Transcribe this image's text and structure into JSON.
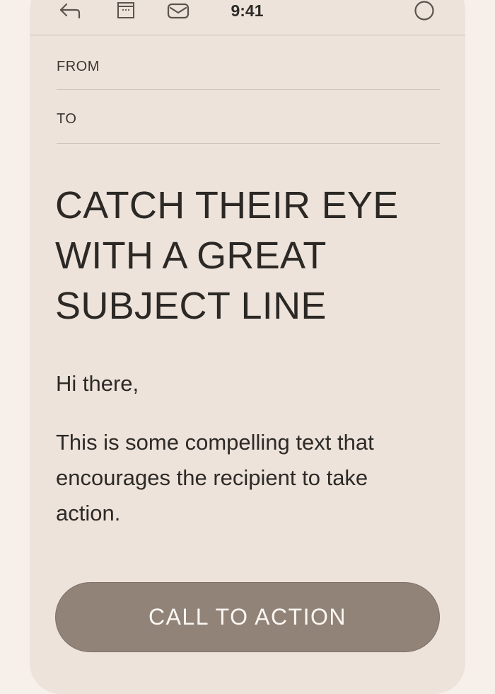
{
  "toolbar": {
    "icons": {
      "back": "reply-back-arrow-icon",
      "archive": "archive-box-icon",
      "mail": "envelope-icon",
      "status": "circle-icon"
    },
    "time": "9:41"
  },
  "fields": {
    "from_label": "FROM",
    "to_label": "TO"
  },
  "email": {
    "subject_lines": [
      "CATCH THEIR EYE",
      "WITH A GREAT",
      "SUBJECT LINE"
    ],
    "greeting": "Hi there,",
    "body_lines": [
      "This is some compelling text that",
      "encourages the recipient to take",
      "action."
    ],
    "cta_label": "CALL TO ACTION"
  },
  "colors": {
    "page_background": "#f7f0ea",
    "card_background": "#ede3da",
    "divider": "#cfc4b9",
    "text": "#2d2a27",
    "cta_background": "#918378",
    "cta_text": "#fbf7f3"
  }
}
